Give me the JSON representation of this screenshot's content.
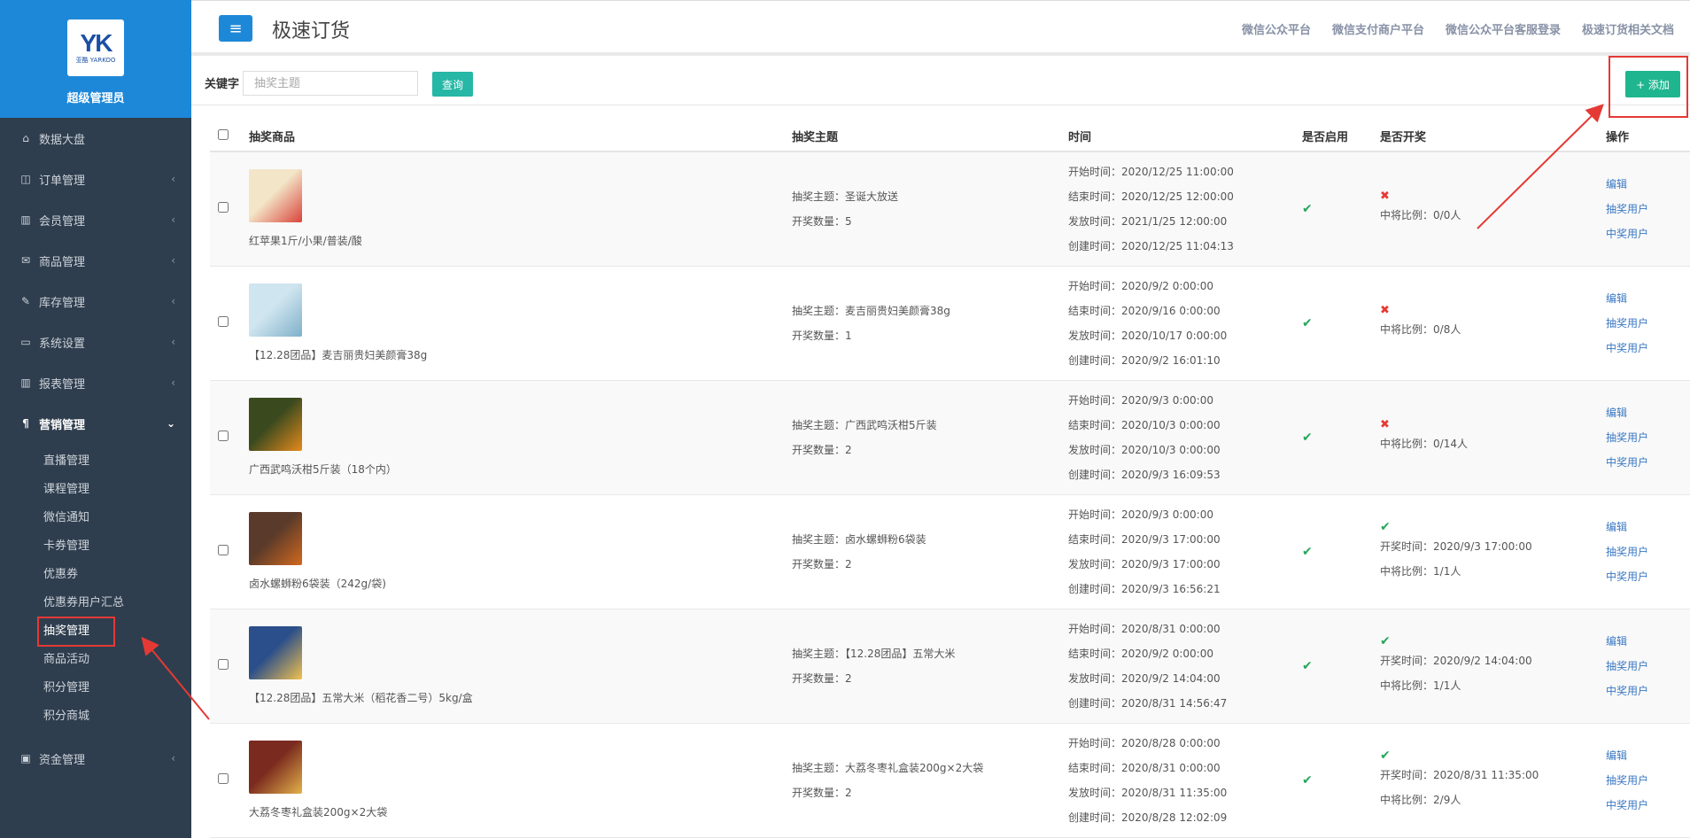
{
  "sidebar": {
    "logo_text": "YK",
    "logo_sub": "亚酷 YARKOO",
    "admin": "超级管理员",
    "items": [
      {
        "label": "数据大盘",
        "icon": "home-icon"
      },
      {
        "label": "订单管理",
        "icon": "columns-icon"
      },
      {
        "label": "会员管理",
        "icon": "bar-chart-icon"
      },
      {
        "label": "商品管理",
        "icon": "envelope-icon"
      },
      {
        "label": "库存管理",
        "icon": "edit-icon"
      },
      {
        "label": "系统设置",
        "icon": "monitor-icon"
      },
      {
        "label": "报表管理",
        "icon": "bar-chart-icon"
      },
      {
        "label": "营销管理",
        "icon": "cutlery-icon"
      },
      {
        "label": "资金管理",
        "icon": "money-icon"
      }
    ],
    "sub_items": [
      "直播管理",
      "课程管理",
      "微信通知",
      "卡券管理",
      "优惠券",
      "优惠券用户汇总",
      "抽奖管理",
      "商品活动",
      "积分管理",
      "积分商城"
    ]
  },
  "header": {
    "title": "极速订货",
    "links": [
      "微信公众平台",
      "微信支付商户平台",
      "微信公众平台客服登录",
      "极速订货相关文档"
    ]
  },
  "toolbar": {
    "keyword_label": "关键字",
    "keyword_placeholder": "抽奖主题",
    "query_label": "查询",
    "add_label": "+ 添加"
  },
  "table": {
    "headers": [
      "抽奖商品",
      "抽奖主题",
      "时间",
      "是否启用",
      "是否开奖",
      "操作"
    ],
    "labels": {
      "theme": "抽奖主题：",
      "count": "开奖数量：",
      "start": "开始时间：",
      "end": "结束时间：",
      "ship": "发放时间：",
      "created": "创建时间：",
      "draw_time": "开奖时间：",
      "ratio": "中将比例："
    },
    "ops": [
      "编辑",
      "抽奖用户",
      "中奖用户"
    ],
    "rows": [
      {
        "product": "红苹果1斤/小果/普装/酸",
        "theme": "圣诞大放送",
        "count": "5",
        "start": "2020/12/25 11:00:00",
        "end": "2020/12/25 12:00:00",
        "ship": "2021/1/25 12:00:00",
        "created": "2020/12/25 11:04:13",
        "drawn": false,
        "draw_time": "",
        "ratio": "0/0人",
        "img": [
          "#f3e6c8",
          "#d9433a"
        ]
      },
      {
        "product": "【12.28团品】麦吉丽贵妇美颜膏38g",
        "theme": "麦吉丽贵妇美颜膏38g",
        "count": "1",
        "start": "2020/9/2 0:00:00",
        "end": "2020/9/16 0:00:00",
        "ship": "2020/10/17 0:00:00",
        "created": "2020/9/2 16:01:10",
        "drawn": false,
        "draw_time": "",
        "ratio": "0/8人",
        "img": [
          "#cfe5ef",
          "#7fb0c9"
        ]
      },
      {
        "product": "广西武鸣沃柑5斤装（18个内）",
        "theme": "广西武鸣沃柑5斤装",
        "count": "2",
        "start": "2020/9/3 0:00:00",
        "end": "2020/10/3 0:00:00",
        "ship": "2020/10/3 0:00:00",
        "created": "2020/9/3 16:09:53",
        "drawn": false,
        "draw_time": "",
        "ratio": "0/14人",
        "img": [
          "#3b4a1e",
          "#e58a1c"
        ]
      },
      {
        "product": "卤水螺蛳粉6袋装（242g/袋)",
        "theme": "卤水螺蛳粉6袋装",
        "count": "2",
        "start": "2020/9/3 0:00:00",
        "end": "2020/9/3 17:00:00",
        "ship": "2020/9/3 17:00:00",
        "created": "2020/9/3 16:56:21",
        "drawn": true,
        "draw_time": "2020/9/3 17:00:00",
        "ratio": "1/1人",
        "img": [
          "#5a3a2a",
          "#d2691e"
        ]
      },
      {
        "product": "【12.28团品】五常大米（稻花香二号）5kg/盒",
        "theme": "【12.28团品】五常大米",
        "count": "2",
        "start": "2020/8/31 0:00:00",
        "end": "2020/9/2 0:00:00",
        "ship": "2020/9/2 14:04:00",
        "created": "2020/8/31 14:56:47",
        "drawn": true,
        "draw_time": "2020/9/2 14:04:00",
        "ratio": "1/1人",
        "img": [
          "#2b4f8a",
          "#f2c14e"
        ]
      },
      {
        "product": "大荔冬枣礼盒装200g×2大袋",
        "theme": "大荔冬枣礼盒装200g×2大袋",
        "count": "2",
        "start": "2020/8/28 0:00:00",
        "end": "2020/8/31 0:00:00",
        "ship": "2020/8/31 11:35:00",
        "created": "2020/8/28 12:02:09",
        "drawn": true,
        "draw_time": "2020/8/31 11:35:00",
        "ratio": "2/9人",
        "img": [
          "#7a2a1e",
          "#e4b24a"
        ]
      }
    ]
  },
  "colors": {
    "sidebar": "#2f3e4e",
    "brand_blue": "#1e88d8",
    "teal": "#26b7a6",
    "green": "#1fb58f",
    "annotation_red": "#e53935"
  }
}
